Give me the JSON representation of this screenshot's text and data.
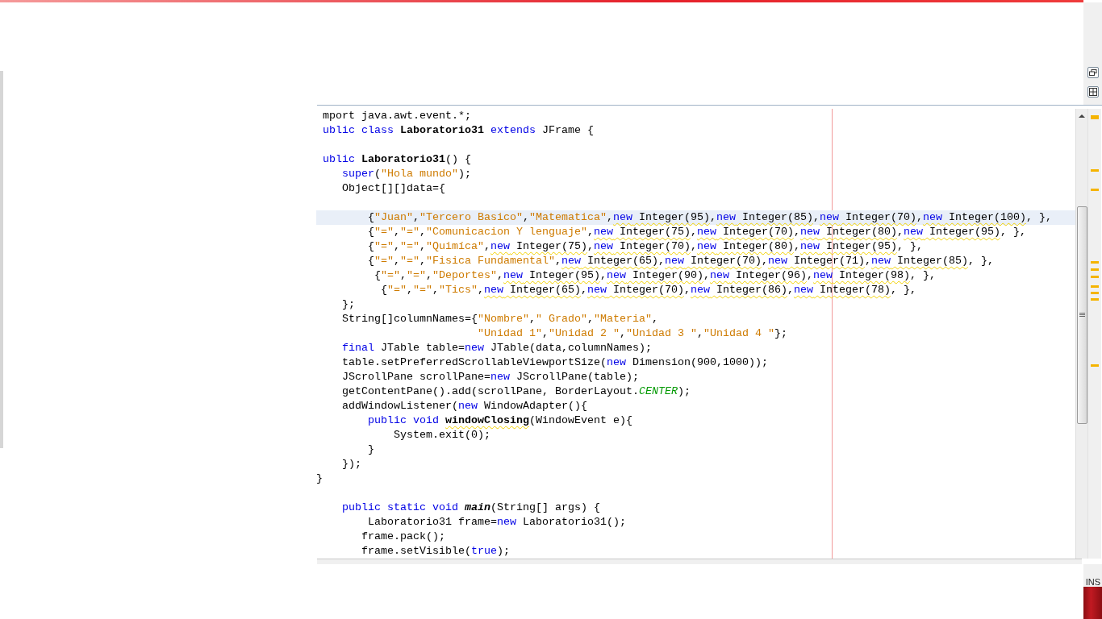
{
  "editor": {
    "lines": [
      {
        "current": false,
        "tokens": [
          {
            "text": " mport java.awt.event.*;",
            "kind": "plain"
          }
        ]
      },
      {
        "current": false,
        "tokens": [
          {
            "text": " ublic class ",
            "kind": "keyword"
          },
          {
            "text": "Laboratorio31",
            "kind": "bold"
          },
          {
            "text": " extends ",
            "kind": "keyword"
          },
          {
            "text": "JFrame {",
            "kind": "plain"
          }
        ]
      },
      {
        "current": false
      },
      {
        "current": false,
        "tokens": [
          {
            "text": " ublic ",
            "kind": "keyword"
          },
          {
            "text": "Laboratorio31",
            "kind": "bold"
          },
          {
            "text": "() {",
            "kind": "plain"
          }
        ]
      },
      {
        "current": false,
        "tokens": [
          {
            "text": "    super",
            "kind": "keyword"
          },
          {
            "text": "(",
            "kind": "plain"
          },
          {
            "text": "\"Hola mundo\"",
            "kind": "string"
          },
          {
            "text": ");",
            "kind": "plain"
          }
        ]
      },
      {
        "current": false,
        "tokens": [
          {
            "text": "    Object[][]data={",
            "kind": "plain"
          }
        ]
      },
      {
        "current": false
      },
      {
        "current": true,
        "tokens": [
          {
            "text": "        {",
            "kind": "plain"
          },
          {
            "text": "\"Juan\"",
            "kind": "string"
          },
          {
            "text": ",",
            "kind": "plain"
          },
          {
            "text": "\"Tercero Basico\"",
            "kind": "string"
          },
          {
            "text": ",",
            "kind": "plain"
          },
          {
            "text": "\"Matematica\"",
            "kind": "string"
          },
          {
            "text": ",",
            "kind": "plain"
          },
          {
            "text": "new",
            "kind": "keyword",
            "warn": true
          },
          {
            "text": " Integer(95)",
            "kind": "plain",
            "warn": true
          },
          {
            "text": ",",
            "kind": "plain"
          },
          {
            "text": "new",
            "kind": "keyword",
            "warn": true
          },
          {
            "text": " Integer(85)",
            "kind": "plain",
            "warn": true
          },
          {
            "text": ",",
            "kind": "plain"
          },
          {
            "text": "new",
            "kind": "keyword",
            "warn": true
          },
          {
            "text": " Integer(70)",
            "kind": "plain",
            "warn": true
          },
          {
            "text": ",",
            "kind": "plain"
          },
          {
            "text": "new",
            "kind": "keyword",
            "warn": true
          },
          {
            "text": " Integer(100)",
            "kind": "plain",
            "warn": true
          },
          {
            "text": ", },",
            "kind": "plain"
          }
        ]
      },
      {
        "current": false,
        "tokens": [
          {
            "text": "        {",
            "kind": "plain"
          },
          {
            "text": "\"=\"",
            "kind": "string"
          },
          {
            "text": ",",
            "kind": "plain"
          },
          {
            "text": "\"=\"",
            "kind": "string"
          },
          {
            "text": ",",
            "kind": "plain"
          },
          {
            "text": "\"Comunicacion Y lenguaje\"",
            "kind": "string"
          },
          {
            "text": ",",
            "kind": "plain"
          },
          {
            "text": "new",
            "kind": "keyword",
            "warn": true
          },
          {
            "text": " Integer(75)",
            "kind": "plain",
            "warn": true
          },
          {
            "text": ",",
            "kind": "plain"
          },
          {
            "text": "new",
            "kind": "keyword",
            "warn": true
          },
          {
            "text": " Integer(70)",
            "kind": "plain",
            "warn": true
          },
          {
            "text": ",",
            "kind": "plain"
          },
          {
            "text": "new",
            "kind": "keyword",
            "warn": true
          },
          {
            "text": " Integer(80)",
            "kind": "plain",
            "warn": true
          },
          {
            "text": ",",
            "kind": "plain"
          },
          {
            "text": "new",
            "kind": "keyword",
            "warn": true
          },
          {
            "text": " Integer(95)",
            "kind": "plain",
            "warn": true
          },
          {
            "text": ", },",
            "kind": "plain"
          }
        ]
      },
      {
        "current": false,
        "tokens": [
          {
            "text": "        {",
            "kind": "plain"
          },
          {
            "text": "\"=\"",
            "kind": "string"
          },
          {
            "text": ",",
            "kind": "plain"
          },
          {
            "text": "\"=\"",
            "kind": "string"
          },
          {
            "text": ",",
            "kind": "plain"
          },
          {
            "text": "\"Quimíca\"",
            "kind": "string"
          },
          {
            "text": ",",
            "kind": "plain"
          },
          {
            "text": "new",
            "kind": "keyword",
            "warn": true
          },
          {
            "text": " Integer(75)",
            "kind": "plain",
            "warn": true
          },
          {
            "text": ",",
            "kind": "plain"
          },
          {
            "text": "new",
            "kind": "keyword",
            "warn": true
          },
          {
            "text": " Integer(70)",
            "kind": "plain",
            "warn": true
          },
          {
            "text": ",",
            "kind": "plain"
          },
          {
            "text": "new",
            "kind": "keyword",
            "warn": true
          },
          {
            "text": " Integer(80)",
            "kind": "plain",
            "warn": true
          },
          {
            "text": ",",
            "kind": "plain"
          },
          {
            "text": "new",
            "kind": "keyword",
            "warn": true
          },
          {
            "text": " Integer(95)",
            "kind": "plain",
            "warn": true
          },
          {
            "text": ", },",
            "kind": "plain"
          }
        ]
      },
      {
        "current": false,
        "tokens": [
          {
            "text": "        {",
            "kind": "plain"
          },
          {
            "text": "\"=\"",
            "kind": "string"
          },
          {
            "text": ",",
            "kind": "plain"
          },
          {
            "text": "\"=\"",
            "kind": "string"
          },
          {
            "text": ",",
            "kind": "plain"
          },
          {
            "text": "\"Fisica Fundamental\"",
            "kind": "string"
          },
          {
            "text": ",",
            "kind": "plain"
          },
          {
            "text": "new",
            "kind": "keyword",
            "warn": true
          },
          {
            "text": " Integer(65)",
            "kind": "plain",
            "warn": true
          },
          {
            "text": ",",
            "kind": "plain"
          },
          {
            "text": "new",
            "kind": "keyword",
            "warn": true
          },
          {
            "text": " Integer(70)",
            "kind": "plain",
            "warn": true
          },
          {
            "text": ",",
            "kind": "plain"
          },
          {
            "text": "new",
            "kind": "keyword",
            "warn": true
          },
          {
            "text": " Integer(71)",
            "kind": "plain",
            "warn": true
          },
          {
            "text": ",",
            "kind": "plain"
          },
          {
            "text": "new",
            "kind": "keyword",
            "warn": true
          },
          {
            "text": " Integer(85)",
            "kind": "plain",
            "warn": true
          },
          {
            "text": ", },",
            "kind": "plain"
          }
        ]
      },
      {
        "current": false,
        "tokens": [
          {
            "text": "         {",
            "kind": "plain"
          },
          {
            "text": "\"=\"",
            "kind": "string"
          },
          {
            "text": ",",
            "kind": "plain"
          },
          {
            "text": "\"=\"",
            "kind": "string"
          },
          {
            "text": ",",
            "kind": "plain"
          },
          {
            "text": "\"Deportes\"",
            "kind": "string"
          },
          {
            "text": ",",
            "kind": "plain"
          },
          {
            "text": "new",
            "kind": "keyword",
            "warn": true
          },
          {
            "text": " Integer(95)",
            "kind": "plain",
            "warn": true
          },
          {
            "text": ",",
            "kind": "plain"
          },
          {
            "text": "new",
            "kind": "keyword",
            "warn": true
          },
          {
            "text": " Integer(90)",
            "kind": "plain",
            "warn": true
          },
          {
            "text": ",",
            "kind": "plain"
          },
          {
            "text": "new",
            "kind": "keyword",
            "warn": true
          },
          {
            "text": " Integer(96)",
            "kind": "plain",
            "warn": true
          },
          {
            "text": ",",
            "kind": "plain"
          },
          {
            "text": "new",
            "kind": "keyword",
            "warn": true
          },
          {
            "text": " Integer(98)",
            "kind": "plain",
            "warn": true
          },
          {
            "text": ", },",
            "kind": "plain"
          }
        ]
      },
      {
        "current": false,
        "tokens": [
          {
            "text": "          {",
            "kind": "plain"
          },
          {
            "text": "\"=\"",
            "kind": "string"
          },
          {
            "text": ",",
            "kind": "plain"
          },
          {
            "text": "\"=\"",
            "kind": "string"
          },
          {
            "text": ",",
            "kind": "plain"
          },
          {
            "text": "\"Tics\"",
            "kind": "string"
          },
          {
            "text": ",",
            "kind": "plain"
          },
          {
            "text": "new",
            "kind": "keyword",
            "warn": true
          },
          {
            "text": " Integer(65)",
            "kind": "plain",
            "warn": true
          },
          {
            "text": ",",
            "kind": "plain"
          },
          {
            "text": "new",
            "kind": "keyword",
            "warn": true
          },
          {
            "text": " Integer(70)",
            "kind": "plain",
            "warn": true
          },
          {
            "text": ",",
            "kind": "plain"
          },
          {
            "text": "new",
            "kind": "keyword",
            "warn": true
          },
          {
            "text": " Integer(86)",
            "kind": "plain",
            "warn": true
          },
          {
            "text": ",",
            "kind": "plain"
          },
          {
            "text": "new",
            "kind": "keyword",
            "warn": true
          },
          {
            "text": " Integer(78)",
            "kind": "plain",
            "warn": true
          },
          {
            "text": ", },",
            "kind": "plain"
          }
        ]
      },
      {
        "current": false,
        "tokens": [
          {
            "text": "    };",
            "kind": "plain"
          }
        ]
      },
      {
        "current": false,
        "tokens": [
          {
            "text": "    String[]columnNames={",
            "kind": "plain"
          },
          {
            "text": "\"Nombre\"",
            "kind": "string"
          },
          {
            "text": ",",
            "kind": "plain"
          },
          {
            "text": "\" Grado\"",
            "kind": "string"
          },
          {
            "text": ",",
            "kind": "plain"
          },
          {
            "text": "\"Materia\"",
            "kind": "string"
          },
          {
            "text": ",",
            "kind": "plain"
          }
        ]
      },
      {
        "current": false,
        "tokens": [
          {
            "text": "                         \"Unidad 1\"",
            "kind": "string"
          },
          {
            "text": ",",
            "kind": "plain"
          },
          {
            "text": "\"Unidad 2 \"",
            "kind": "string"
          },
          {
            "text": ",",
            "kind": "plain"
          },
          {
            "text": "\"Unidad 3 \"",
            "kind": "string"
          },
          {
            "text": ",",
            "kind": "plain"
          },
          {
            "text": "\"Unidad 4 \"",
            "kind": "string"
          },
          {
            "text": "};",
            "kind": "plain"
          }
        ]
      },
      {
        "current": false,
        "tokens": [
          {
            "text": "    final",
            "kind": "keyword"
          },
          {
            "text": " JTable table=",
            "kind": "plain"
          },
          {
            "text": "new",
            "kind": "keyword"
          },
          {
            "text": " JTable(data,columnNames);",
            "kind": "plain"
          }
        ]
      },
      {
        "current": false,
        "tokens": [
          {
            "text": "    table.setPreferredScrollableViewportSize(",
            "kind": "plain"
          },
          {
            "text": "new",
            "kind": "keyword"
          },
          {
            "text": " Dimension(900,1000));",
            "kind": "plain"
          }
        ]
      },
      {
        "current": false,
        "tokens": [
          {
            "text": "    JScrollPane scrollPane=",
            "kind": "plain"
          },
          {
            "text": "new",
            "kind": "keyword"
          },
          {
            "text": " JScrollPane(table);",
            "kind": "plain"
          }
        ]
      },
      {
        "current": false,
        "tokens": [
          {
            "text": "    getContentPane().add(scrollPane, BorderLayout.",
            "kind": "plain"
          },
          {
            "text": "CENTER",
            "kind": "constant"
          },
          {
            "text": ");",
            "kind": "plain"
          }
        ]
      },
      {
        "current": false,
        "tokens": [
          {
            "text": "    addWindowListener(",
            "kind": "plain"
          },
          {
            "text": "new",
            "kind": "keyword"
          },
          {
            "text": " WindowAdapter(){",
            "kind": "plain"
          }
        ]
      },
      {
        "current": false,
        "tokens": [
          {
            "text": "        public void ",
            "kind": "keyword"
          },
          {
            "text": "windowClosing",
            "kind": "bold",
            "warn": true
          },
          {
            "text": "(WindowEvent e){",
            "kind": "plain"
          }
        ]
      },
      {
        "current": false,
        "tokens": [
          {
            "text": "            System.exit(0);",
            "kind": "plain"
          }
        ]
      },
      {
        "current": false,
        "tokens": [
          {
            "text": "        }",
            "kind": "plain"
          }
        ]
      },
      {
        "current": false,
        "tokens": [
          {
            "text": "    });",
            "kind": "plain"
          }
        ]
      },
      {
        "current": false,
        "tokens": [
          {
            "text": "}",
            "kind": "plain"
          }
        ]
      },
      {
        "current": false
      },
      {
        "current": false,
        "tokens": [
          {
            "text": "    public static void ",
            "kind": "keyword"
          },
          {
            "text": "main",
            "kind": "bolditalic"
          },
          {
            "text": "(String[] args) {",
            "kind": "plain"
          }
        ]
      },
      {
        "current": false,
        "tokens": [
          {
            "text": "        Laboratorio31 frame=",
            "kind": "plain"
          },
          {
            "text": "new",
            "kind": "keyword"
          },
          {
            "text": " Laboratorio31();",
            "kind": "plain"
          }
        ]
      },
      {
        "current": false,
        "tokens": [
          {
            "text": "       frame.pack();",
            "kind": "plain"
          }
        ]
      },
      {
        "current": false,
        "tokens": [
          {
            "text": "       frame.setVisible(",
            "kind": "plain"
          },
          {
            "text": "true",
            "kind": "keyword"
          },
          {
            "text": ");",
            "kind": "plain"
          }
        ]
      }
    ]
  },
  "status_bar": {
    "mode": "INS"
  }
}
